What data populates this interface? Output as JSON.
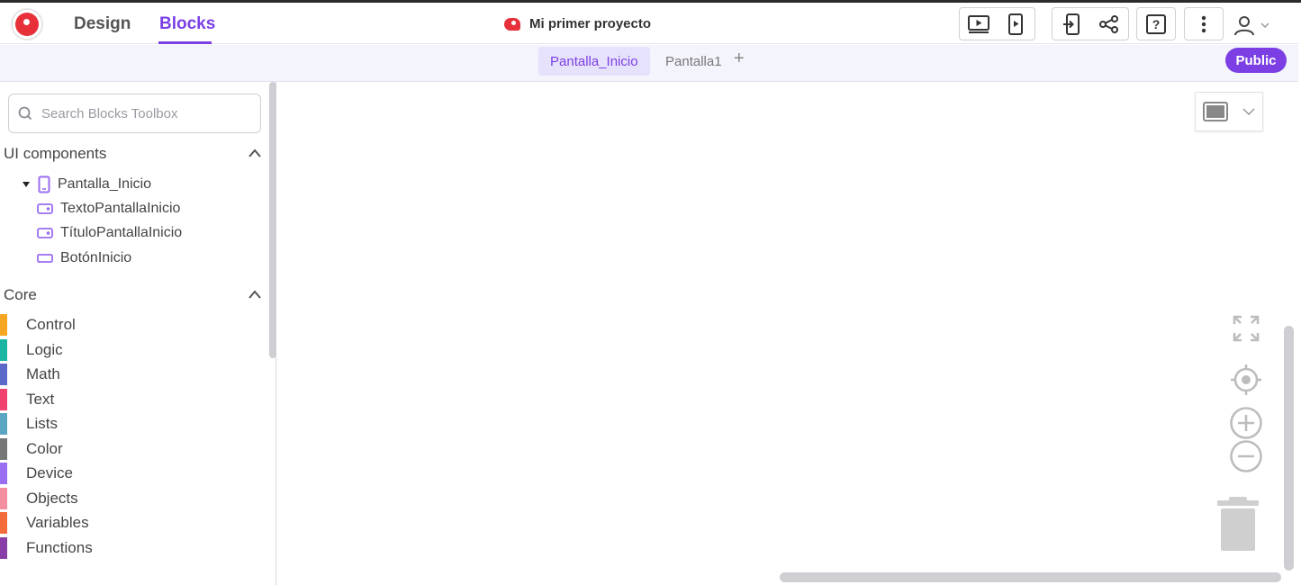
{
  "header": {
    "nav": {
      "design_label": "Design",
      "blocks_label": "Blocks",
      "active": "Blocks"
    },
    "project_name": "Mi primer proyecto",
    "toolbar_icons": [
      "preview-icon",
      "device-preview-icon",
      "import-icon",
      "share-icon",
      "help-icon",
      "more-icon",
      "account-icon"
    ]
  },
  "screens": {
    "tabs": [
      {
        "label": "Pantalla_Inicio",
        "active": true
      },
      {
        "label": "Pantalla1",
        "active": false
      }
    ],
    "add_label": "+",
    "public_label": "Public"
  },
  "sidebar": {
    "search_placeholder": "Search Blocks Toolbox",
    "ui_components": {
      "title": "UI components",
      "screen": "Pantalla_Inicio",
      "children": [
        "TextoPantallaInicio",
        "TítuloPantallaInicio",
        "BotónInicio"
      ]
    },
    "core": {
      "title": "Core",
      "categories": [
        {
          "label": "Control",
          "color": "#f5a623"
        },
        {
          "label": "Logic",
          "color": "#1bb6a3"
        },
        {
          "label": "Math",
          "color": "#5b6ac8"
        },
        {
          "label": "Text",
          "color": "#f0416f"
        },
        {
          "label": "Lists",
          "color": "#5aa6c2"
        },
        {
          "label": "Color",
          "color": "#777777"
        },
        {
          "label": "Device",
          "color": "#9a6ef0"
        },
        {
          "label": "Objects",
          "color": "#f48fa0"
        },
        {
          "label": "Variables",
          "color": "#f36b3b"
        },
        {
          "label": "Functions",
          "color": "#8a3fa8"
        }
      ]
    }
  },
  "colors": {
    "accent": "#7b3fe4",
    "brand_red": "#e8303a"
  }
}
